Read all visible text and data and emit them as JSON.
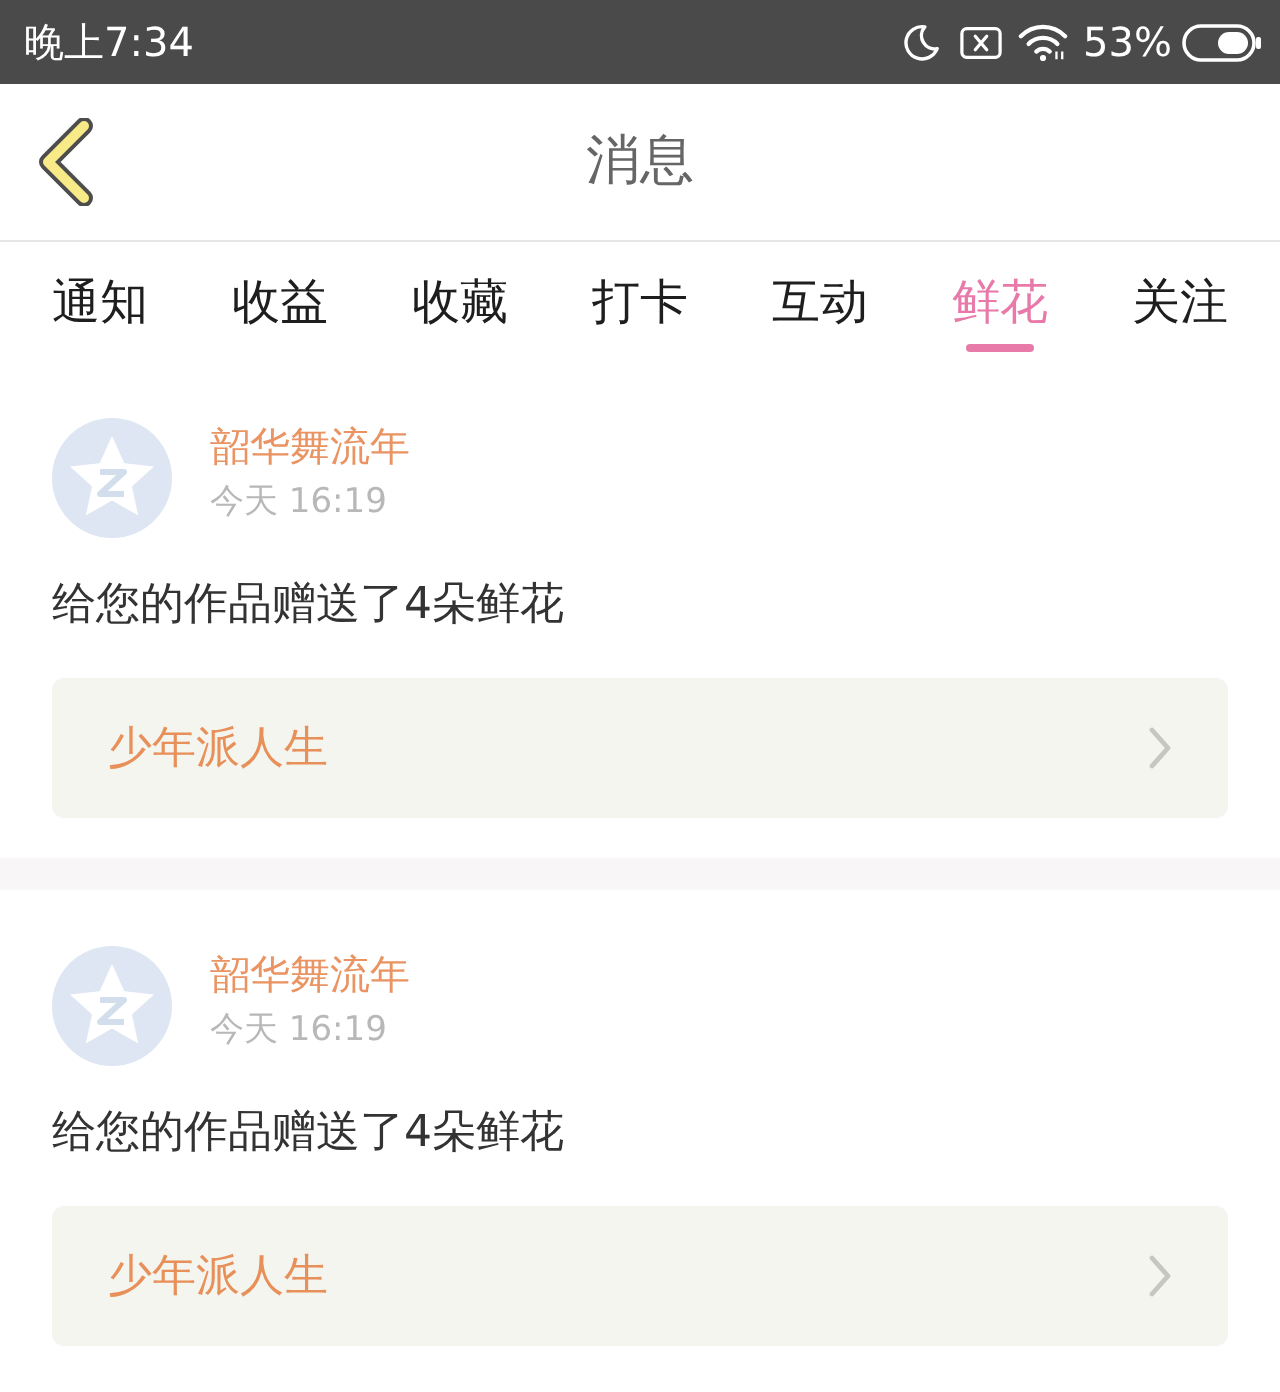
{
  "status_bar": {
    "time": "晚上7:34",
    "battery": "53%"
  },
  "header": {
    "title": "消息"
  },
  "tabs": [
    {
      "label": "通知",
      "selected": false
    },
    {
      "label": "收益",
      "selected": false
    },
    {
      "label": "收藏",
      "selected": false
    },
    {
      "label": "打卡",
      "selected": false
    },
    {
      "label": "互动",
      "selected": false
    },
    {
      "label": "鲜花",
      "selected": true
    },
    {
      "label": "关注",
      "selected": false
    }
  ],
  "messages": [
    {
      "sender": "韶华舞流年",
      "time": "今天 16:19",
      "text": "给您的作品赠送了4朵鲜花",
      "work": "少年派人生"
    },
    {
      "sender": "韶华舞流年",
      "time": "今天 16:19",
      "text": "给您的作品赠送了4朵鲜花",
      "work": "少年派人生"
    }
  ]
}
